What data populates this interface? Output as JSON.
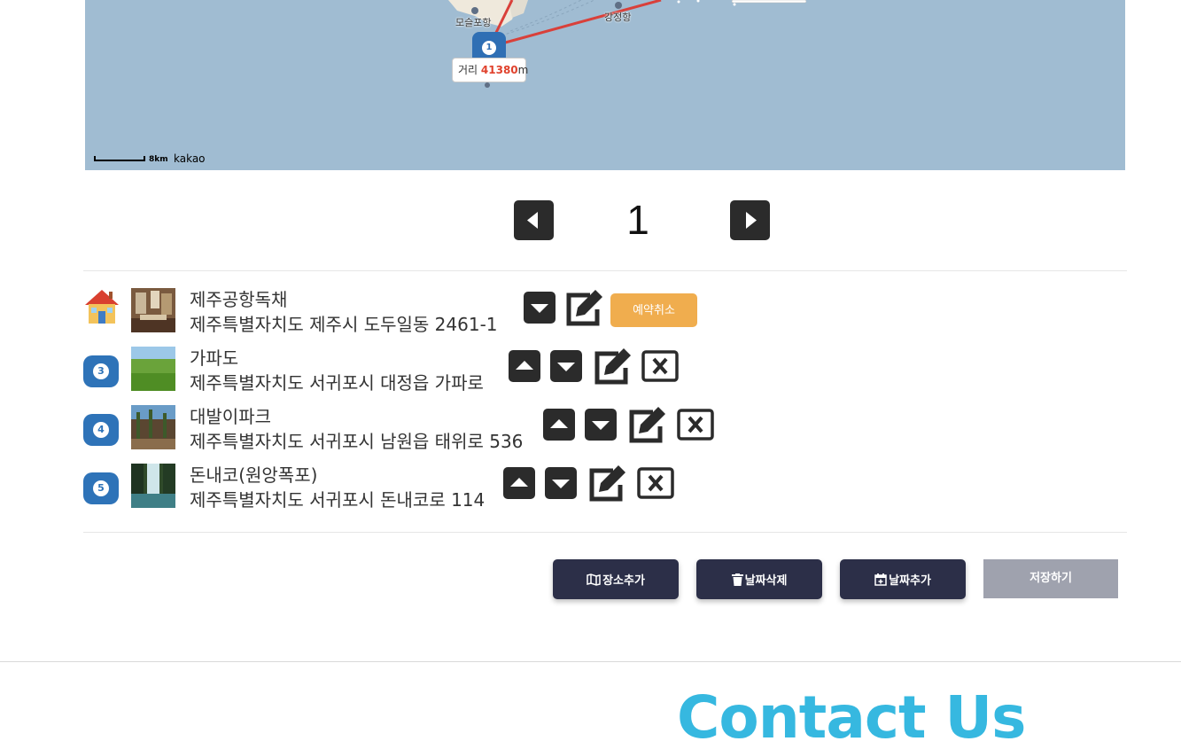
{
  "map": {
    "labels": [
      "모슬포항",
      "강정항"
    ],
    "marker_number": "1",
    "distance": {
      "prefix": "거리 ",
      "value": "41380",
      "unit": "m"
    },
    "scale_text": "8km",
    "provider": "kakao",
    "route_color": "#d9403a"
  },
  "pager": {
    "current_page": "1",
    "prev_icon": "caret-left-icon",
    "next_icon": "caret-right-icon"
  },
  "itinerary": [
    {
      "marker": "house-icon",
      "name": "제주공항독채",
      "address": "제주특별자치도 제주시 도두일동 2461-1",
      "extra_button": "예약취소"
    },
    {
      "marker": "3",
      "name": "가파도",
      "address": "제주특별자치도 서귀포시 대정읍 가파로"
    },
    {
      "marker": "4",
      "name": "대발이파크",
      "address": "제주특별자치도 서귀포시 남원읍 태위로 536"
    },
    {
      "marker": "5",
      "name": "돈내코(원앙폭포)",
      "address": "제주특별자치도 서귀포시 돈내코로 114"
    }
  ],
  "actions": {
    "add_place": "장소추가",
    "delete_day": "날짜삭제",
    "add_day": "날짜추가",
    "save": "저장하기"
  },
  "footer": {
    "title": "Contact Us"
  },
  "colors": {
    "map_water": "#a0bcd2",
    "marker_blue": "#2e73b8",
    "cancel_orange": "#f0ad4e",
    "button_navy": "#2c2f48",
    "save_disabled": "#9fa2ae",
    "contact_blue": "#36b8e0"
  }
}
